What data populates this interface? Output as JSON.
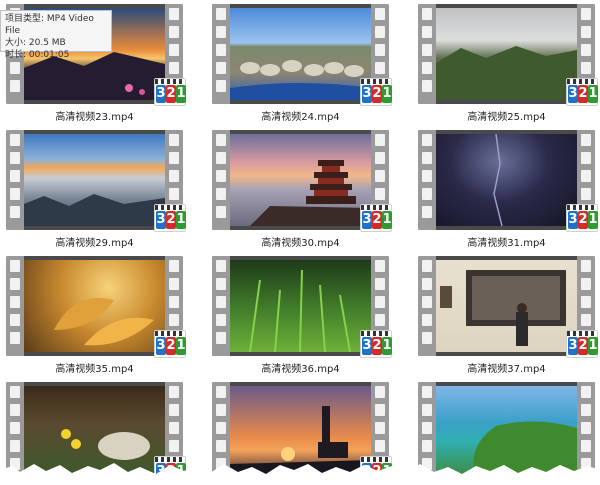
{
  "tooltip": {
    "type_line": "项目类型: MP4 Video File",
    "size_line": "大小: 20.5 MB",
    "duration_line": "时长: 00:01:05"
  },
  "badge_digits": [
    "3",
    "2",
    "1"
  ],
  "badge_colors": [
    "#1e73c8",
    "#d42a2a",
    "#2f9a2f"
  ],
  "files": [
    {
      "name": "高清视频23.mp4",
      "thumb": "sunset-clouds-mountains"
    },
    {
      "name": "高清视频24.mp4",
      "thumb": "sheep-herd-road"
    },
    {
      "name": "高清视频25.mp4",
      "thumb": "cloudy-forest-hills"
    },
    {
      "name": "高清视频29.mp4",
      "thumb": "sea-of-clouds"
    },
    {
      "name": "高清视频30.mp4",
      "thumb": "pagoda-sunset"
    },
    {
      "name": "高清视频31.mp4",
      "thumb": "dark-cave-light"
    },
    {
      "name": "高清视频35.mp4",
      "thumb": "autumn-leaves"
    },
    {
      "name": "高清视频36.mp4",
      "thumb": "green-grass"
    },
    {
      "name": "高清视频37.mp4",
      "thumb": "art-gallery-visitor"
    },
    {
      "name": "",
      "thumb": "mushroom-yellow-flowers"
    },
    {
      "name": "",
      "thumb": "lighthouse-sunset"
    },
    {
      "name": "",
      "thumb": "tropical-coast-aerial"
    }
  ]
}
